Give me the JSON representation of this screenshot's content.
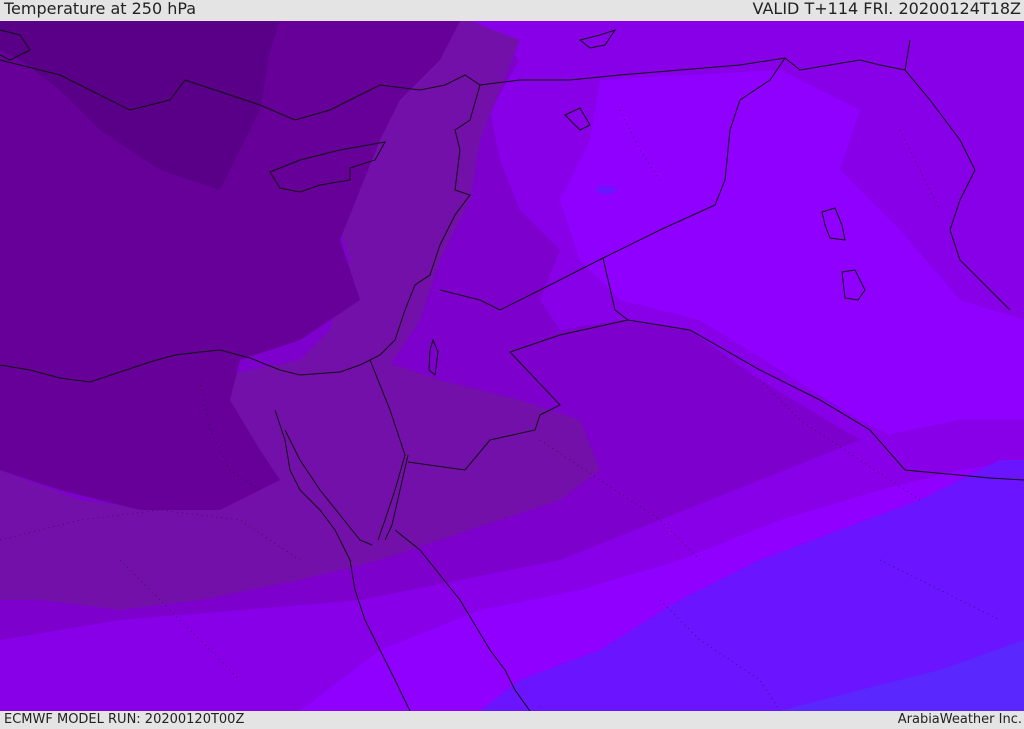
{
  "header": {
    "title": "Temperature at 250 hPa",
    "valid": "VALID T+114 FRI. 20200124T18Z"
  },
  "footer": {
    "model_run": "ECMWF MODEL RUN: 20200120T00Z",
    "brand": "ArabiaWeather Inc."
  },
  "colors": {
    "band_darkest": "#5a0088",
    "band_dark": "#660099",
    "band_mid": "#7310aa",
    "band_violet": "#7d00cc",
    "band_bright": "#8800e8",
    "band_brightest": "#8f00ff",
    "band_blue": "#6a14ff",
    "band_blue2": "#5a28ff",
    "coastline": "#111111"
  }
}
